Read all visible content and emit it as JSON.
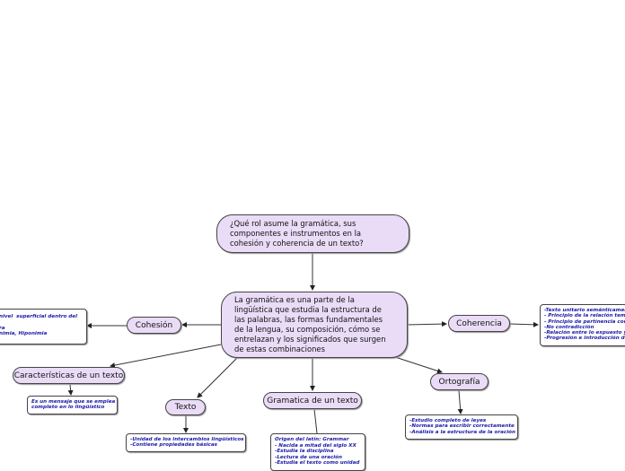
{
  "question": "¿Qué rol asume la gramática, sus componentes e instrumentos en la cohesión y coherencia de un texto?",
  "central": "La gramática es una parte de la lingüística que estudia la estructura de las palabras, las formas fundamentales de la lengua, su composición, cómo se entrelazan y los significados que surgen de estas combinaciones",
  "topics": {
    "cohesion": "Cohesión",
    "coherencia": "Coherencia",
    "caracteristicas": "Características de un texto",
    "texto": "Texto",
    "gramatica": "Gramatica de un texto",
    "ortografia": "Ortografía"
  },
  "notes": {
    "cohesion": "nivel  superficial dentro del\n\nra\nnimia, Hiponimia",
    "coherencia": "-Texto unitario semánticamente\n- Principio de la relación temática\n- Principio de pertinencia con\n-No contradicción\n-Relación entre lo expuesto y\n-Progresión e introducción de",
    "caracteristicas": "Es un mensaje que se emplea\ncompleto en lo lingüístico",
    "texto": "-Unidad de los intercambios lingüísticos\n-Contiene propiedades básicas",
    "gramatica": "Origen del latín: Grammar\n- Nacida a mitad del siglo XX\n-Estudia la disciplina\n-Lectura de una oración\n-Estudia el texto como unidad",
    "ortografia": "-Estudio completo de leyes\n-Normas para escribir correctamente\n-Análisis a la estructura de la oración"
  },
  "colors": {
    "node_fill": "#eadcf7",
    "note_text": "#1a1aa8"
  }
}
